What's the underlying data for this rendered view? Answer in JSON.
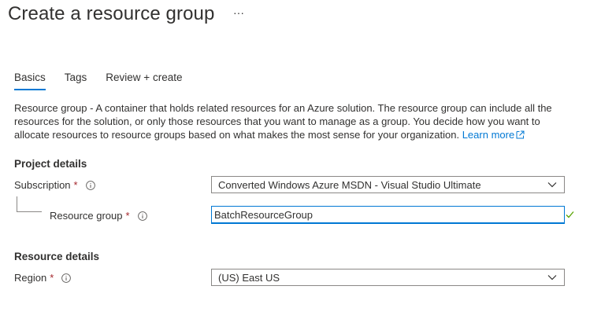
{
  "header": {
    "title": "Create a resource group",
    "more_label": "···"
  },
  "tabs": [
    {
      "label": "Basics",
      "active": true
    },
    {
      "label": "Tags",
      "active": false
    },
    {
      "label": "Review + create",
      "active": false
    }
  ],
  "description": {
    "term": "Resource group",
    "text": " - A container that holds related resources for an Azure solution. The resource group can include all the resources for the solution, or only those resources that you want to manage as a group. You decide how you want to allocate resources to resource groups based on what makes the most sense for your organization. ",
    "learn_more": "Learn more"
  },
  "project_details": {
    "heading": "Project details",
    "subscription": {
      "label": "Subscription",
      "required_mark": "*",
      "value": "Converted Windows Azure MSDN - Visual Studio Ultimate"
    },
    "resource_group": {
      "label": "Resource group",
      "required_mark": "*",
      "value": "BatchResourceGroup",
      "valid": true
    }
  },
  "resource_details": {
    "heading": "Resource details",
    "region": {
      "label": "Region",
      "required_mark": "*",
      "value": "(US) East US"
    }
  },
  "colors": {
    "accent": "#0078d4",
    "required": "#a4262c",
    "valid": "#57a300",
    "text": "#323130"
  },
  "icons": {
    "info": "info-icon",
    "chevron": "chevron-down-icon",
    "external": "external-link-icon",
    "check": "checkmark-icon",
    "more": "ellipsis-icon"
  }
}
